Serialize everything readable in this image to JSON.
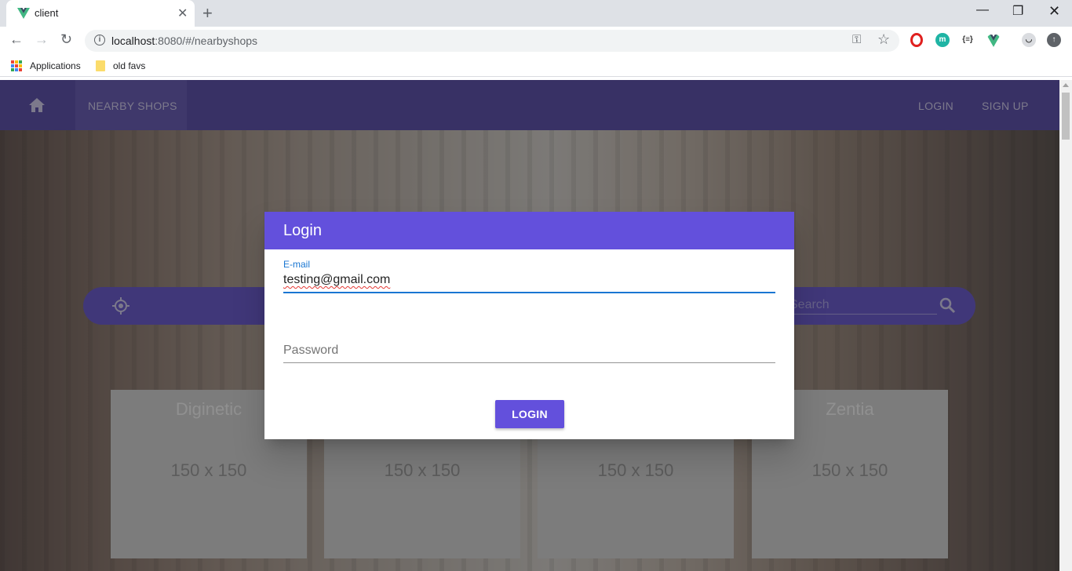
{
  "browser": {
    "tab_title": "client",
    "url_host": "localhost",
    "url_rest": ":8080/#/nearbyshops",
    "bookmarks": [
      "Applications",
      "old favs"
    ],
    "extension_label": "{≡}",
    "extension_m": "m"
  },
  "appbar": {
    "nav_label": "NEARBY SHOPS",
    "login_label": "LOGIN",
    "signup_label": "SIGN UP"
  },
  "search": {
    "placeholder": "Search"
  },
  "shops": [
    {
      "name": "Diginetic",
      "image_text": "150 x 150"
    },
    {
      "name": "",
      "image_text": "150 x 150"
    },
    {
      "name": "",
      "image_text": "150 x 150"
    },
    {
      "name": "Zentia",
      "image_text": "150 x 150"
    }
  ],
  "dialog": {
    "title": "Login",
    "email_label": "E-mail",
    "email_value": "testing@gmail.com",
    "password_placeholder": "Password",
    "submit_label": "LOGIN"
  },
  "colors": {
    "appbar": "#4d3fa0",
    "dialog_header": "#6350dc",
    "focus": "#1976d2"
  }
}
